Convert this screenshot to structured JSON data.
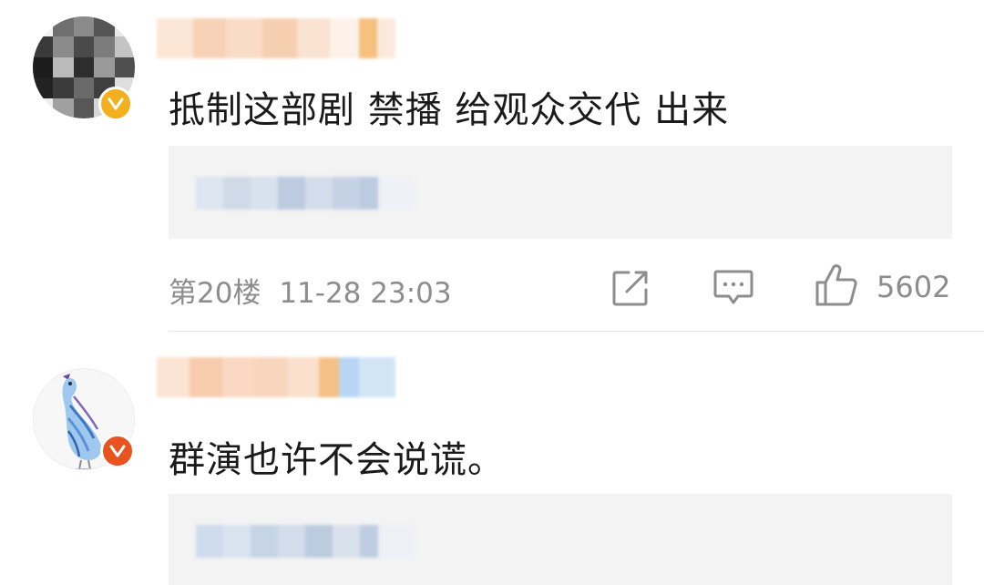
{
  "comments": [
    {
      "text": "抵制这部剧 禁播 给观众交代 出来",
      "floor": "第20楼",
      "timestamp": "11-28 23:03",
      "likes": "5602",
      "badge_color": "#f2b01e",
      "avatar_icon": "pixelated-avatar",
      "icons": {
        "repost": "repost-icon",
        "comment": "comment-icon",
        "like": "thumbs-up-icon"
      }
    },
    {
      "text": "群演也许不会说谎。",
      "badge_color": "#e8531f",
      "avatar_icon": "bird-illustration-avatar"
    }
  ],
  "colors": {
    "text": "#1a1a1a",
    "meta": "#8d8d8d",
    "reply_bg": "#f3f3f3",
    "divider": "#e6e6e6"
  }
}
